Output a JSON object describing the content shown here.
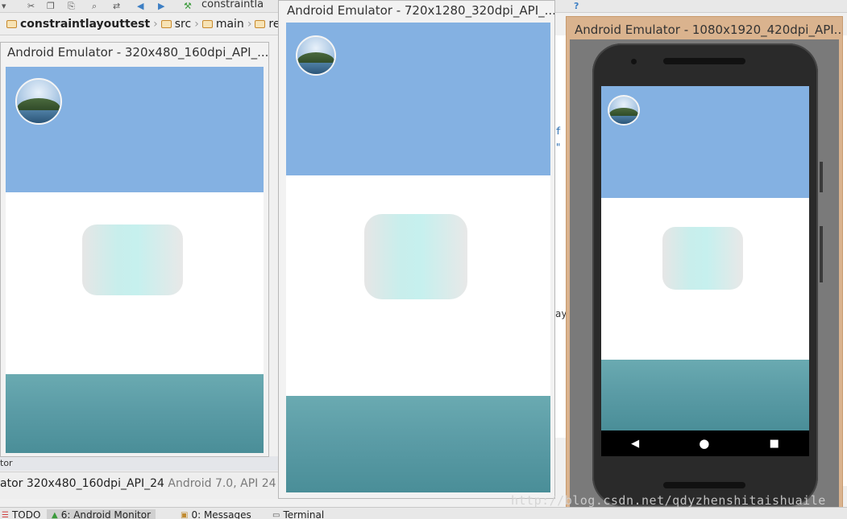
{
  "ide": {
    "breadcrumb": [
      "constraintlayouttest",
      "src",
      "main",
      "res"
    ],
    "top_tab": "constraintla",
    "status_line1": "tor",
    "status_emulator": "ator 320x480_160dpi_API_24",
    "status_android": "Android 7.0, API 24",
    "bottom_tabs": [
      "TODO",
      "6: Android Monitor",
      "0: Messages",
      "Terminal"
    ]
  },
  "emulators": [
    {
      "title": "Android Emulator - 320x480_160dpi_API_..."
    },
    {
      "title": "Android Emulator - 720x1280_320dpi_API_..."
    },
    {
      "title": "Android Emulator - 1080x1920_420dpi_API..."
    }
  ],
  "watermark": "http://blog.csdn.net/qdyzhenshitaishuaile"
}
